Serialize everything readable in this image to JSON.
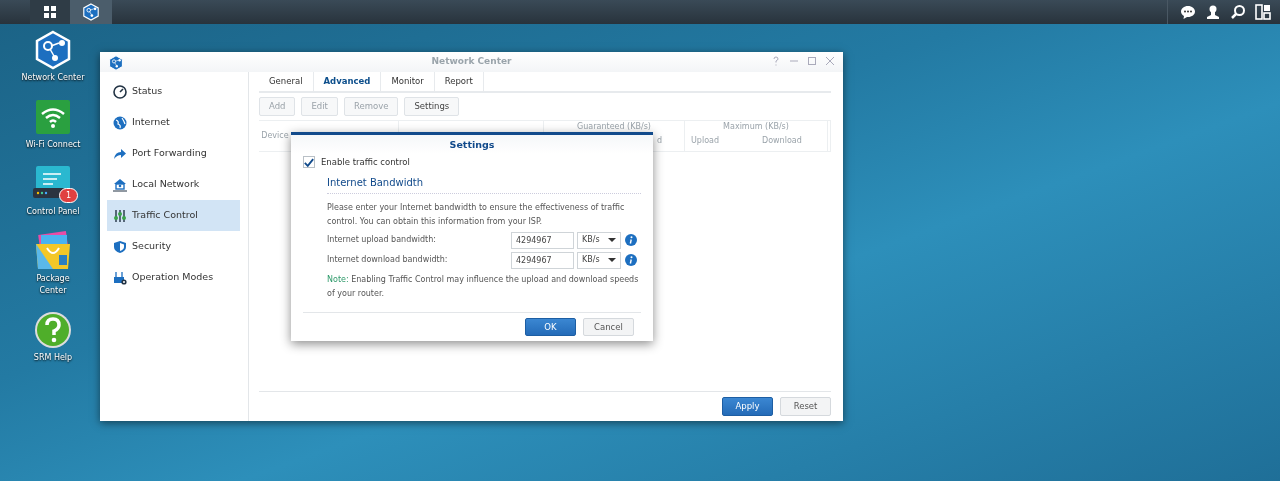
{
  "taskbar": {
    "buttons": [
      {
        "kind": "main-menu",
        "selected": false
      },
      {
        "kind": "app",
        "selected": true
      }
    ]
  },
  "desktop_icons": [
    {
      "label": "Network Center"
    },
    {
      "label": "Wi-Fi Connect"
    },
    {
      "label": "Control Panel",
      "badge": "1"
    },
    {
      "label": "Package Center"
    },
    {
      "label": "SRM Help"
    }
  ],
  "window": {
    "title": "Network Center",
    "sidebar": {
      "items": [
        {
          "label": "Status",
          "selected": false
        },
        {
          "label": "Internet",
          "selected": false
        },
        {
          "label": "Port Forwarding",
          "selected": false
        },
        {
          "label": "Local Network",
          "selected": false
        },
        {
          "label": "Traffic Control",
          "selected": true
        },
        {
          "label": "Security",
          "selected": false
        },
        {
          "label": "Operation Modes",
          "selected": false
        }
      ]
    },
    "tabs": [
      {
        "label": "General",
        "selected": false
      },
      {
        "label": "Advanced",
        "selected": true
      },
      {
        "label": "Monitor",
        "selected": false
      },
      {
        "label": "Report",
        "selected": false
      }
    ],
    "toolbar": [
      {
        "label": "Add",
        "disabled": true
      },
      {
        "label": "Edit",
        "disabled": true
      },
      {
        "label": "Remove",
        "disabled": true
      },
      {
        "label": "Settings",
        "disabled": false
      }
    ],
    "table": {
      "column_1": "Device",
      "guaranteed": {
        "label": "Guaranteed (KB/s)",
        "column_2": "d"
      },
      "maximum": {
        "label": "Maximum (KB/s)",
        "upload": "Upload",
        "download": "Download"
      }
    },
    "buttons": [
      {
        "label": "Apply",
        "kind": "primary"
      },
      {
        "label": "Reset",
        "kind": "secondary"
      }
    ]
  },
  "dialog": {
    "title": "Settings",
    "enable": {
      "label": "Enable traffic control",
      "checked": true
    },
    "section": "Internet Bandwidth",
    "description": "Please enter your Internet bandwidth to ensure the effectiveness of traffic control. You can obtain this information from your ISP.",
    "fields": [
      {
        "label": "Internet upload bandwidth:",
        "value": "4294967",
        "unit": "KB/s"
      },
      {
        "label": "Internet download bandwidth:",
        "value": "4294967",
        "unit": "KB/s"
      }
    ],
    "note": {
      "prefix": "Note:",
      "text": "Enabling Traffic Control may influence the upload and download speeds of your router."
    },
    "buttons": [
      {
        "label": "OK",
        "kind": "primary"
      },
      {
        "label": "Cancel",
        "kind": "secondary"
      }
    ]
  }
}
